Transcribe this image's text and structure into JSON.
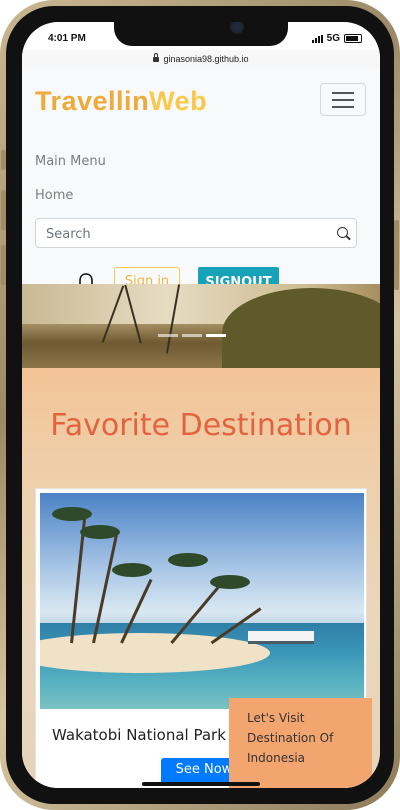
{
  "status": {
    "time": "4:01 PM",
    "network": "5G"
  },
  "browser": {
    "url": "ginasonia98.github.io"
  },
  "nav": {
    "brand_part1": "Travellin",
    "brand_part2": "Web",
    "links": [
      "Main Menu",
      "Home"
    ],
    "search_placeholder": "Search",
    "signin_label": "Sign in",
    "signout_label": "SIGNOUT"
  },
  "hero": {
    "slides": 3,
    "active_slide": 3
  },
  "section": {
    "title": "Favorite Destination",
    "card": {
      "name": "Wakatobi National Park",
      "button_label": "See Now"
    }
  },
  "promo": {
    "text": "Let's Visit Destination Of Indonesia"
  },
  "colors": {
    "brand_orange": "#f0a93b",
    "brand_yellow": "#f8c94c",
    "signout_teal": "#17a2b8",
    "title_coral": "#e4633f",
    "primary_blue": "#007bff",
    "promo_bg": "#f3a570"
  }
}
